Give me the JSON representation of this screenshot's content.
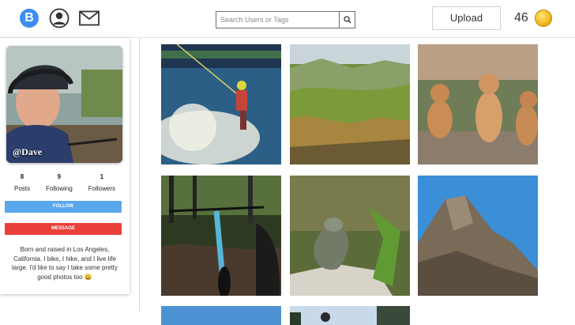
{
  "header": {
    "logo_letter": "B",
    "search_placeholder": "Search Users or Tags",
    "upload_label": "Upload",
    "coin_count": "46"
  },
  "profile": {
    "handle": "@Dave",
    "stats": [
      {
        "value": "8",
        "label": "Posts"
      },
      {
        "value": "9",
        "label": "Following"
      },
      {
        "value": "1",
        "label": "Followers"
      }
    ],
    "follow_label": "FOLLOW",
    "message_label": "MESSAGE",
    "bio": "Born and raised in Los Angeles, California. I bike, I hike, and I live life large. I'd like to say I take some pretty good photos too 😀"
  },
  "colors": {
    "follow": "#5aa7ec",
    "message": "#e9403a",
    "logo": "#3d8df5"
  }
}
